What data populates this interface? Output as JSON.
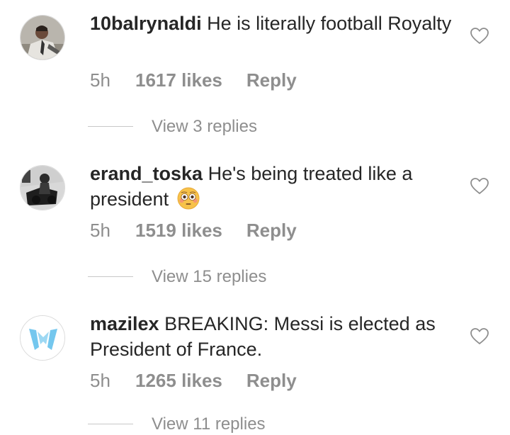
{
  "comments": [
    {
      "username": "10balrynaldi",
      "text": "He is literally football Royalty",
      "time": "5h",
      "likes": "1617 likes",
      "reply": "Reply",
      "view_replies": "View 3 replies",
      "avatar_icon": "user-photo-avatar"
    },
    {
      "username": "erand_toska",
      "text": "He's being treated like a president",
      "emoji": "flushed-face-emoji",
      "time": "5h",
      "likes": "1519 likes",
      "reply": "Reply",
      "view_replies": "View 15 replies",
      "avatar_icon": "photo-avatar"
    },
    {
      "username": "mazilex",
      "text": "BREAKING: Messi is elected as President of France.",
      "time": "5h",
      "likes": "1265 likes",
      "reply": "Reply",
      "view_replies": "View 11 replies",
      "avatar_icon": "messi-logo-avatar"
    }
  ],
  "colors": {
    "text": "#262626",
    "secondary": "#8e8e8e",
    "divider": "#c7c7c7",
    "logo_blue": "#74c7ee"
  }
}
